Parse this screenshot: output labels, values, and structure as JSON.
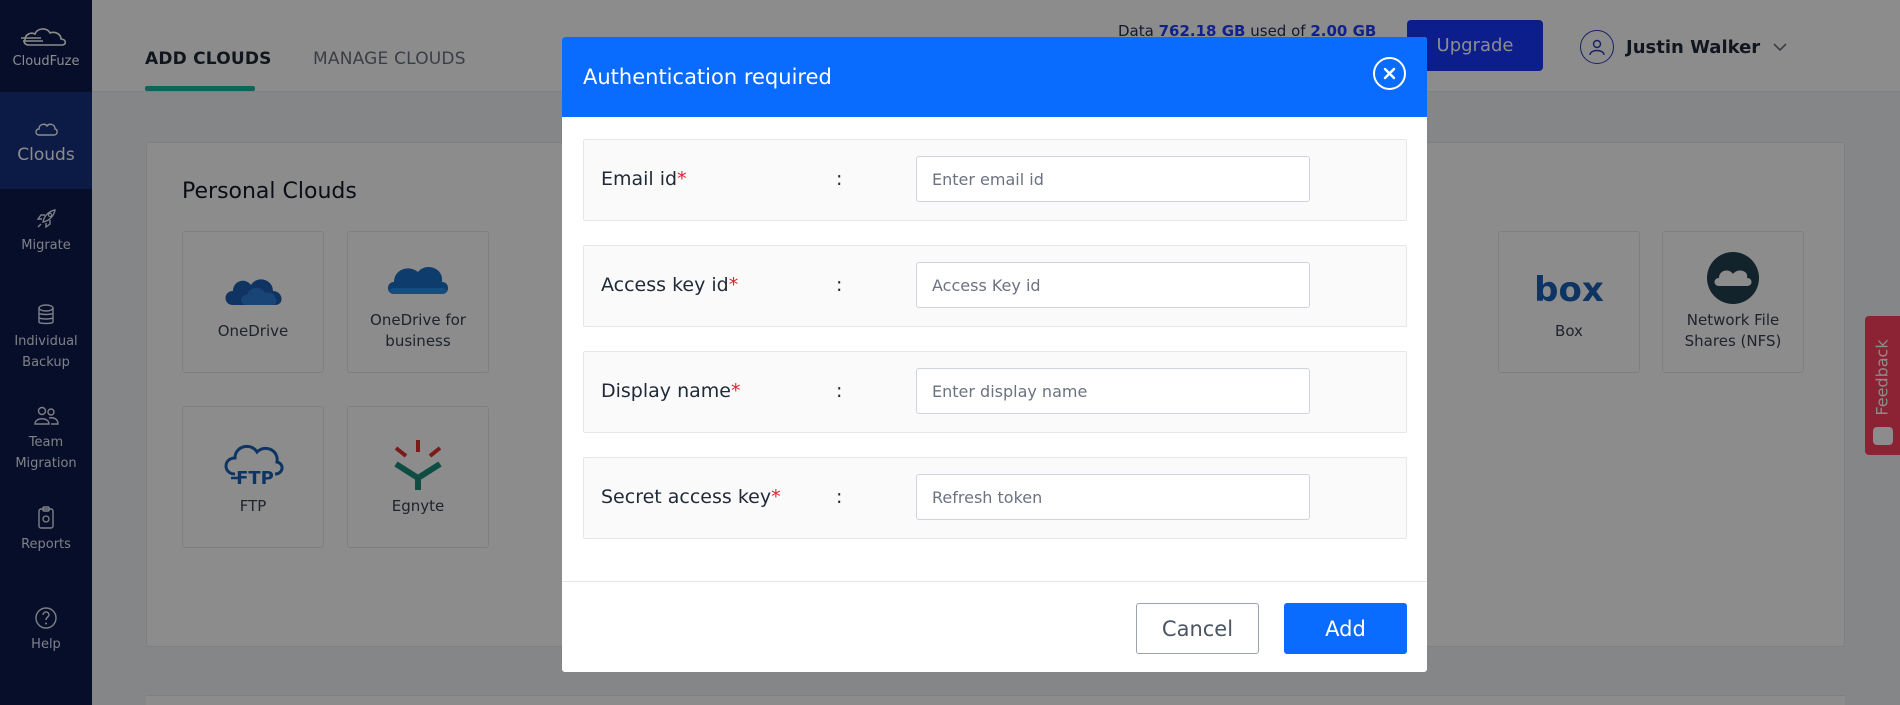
{
  "app": {
    "logo_text": "CloudFuze"
  },
  "sidebar": {
    "items": [
      {
        "label": "Clouds",
        "icon": "cloud-icon",
        "active": true
      },
      {
        "label": "Migrate",
        "icon": "rocket-icon"
      },
      {
        "label": "Individual Backup",
        "icon": "database-icon"
      },
      {
        "label": "Team Migration",
        "icon": "team-icon"
      },
      {
        "label": "Reports",
        "icon": "reports-icon"
      },
      {
        "label": "Help",
        "icon": "help-icon"
      }
    ]
  },
  "header": {
    "tabs": [
      {
        "label": "ADD CLOUDS",
        "active": true
      },
      {
        "label": "MANAGE CLOUDS",
        "active": false
      }
    ],
    "usage_prefix": "Data",
    "usage_used": "762.18 GB",
    "usage_middle": "used of",
    "usage_total": "2.00 GB",
    "upgrade_label": "Upgrade",
    "user_name": "Justin Walker"
  },
  "main": {
    "section_title": "Personal Clouds",
    "tiles": [
      {
        "label": "OneDrive",
        "icon": "onedrive-icon"
      },
      {
        "label": "OneDrive for business",
        "icon": "onedrive-business-icon"
      },
      {
        "label": "Box",
        "icon": "box-icon"
      },
      {
        "label": "Network File Shares (NFS)",
        "icon": "nfs-icon"
      },
      {
        "label": "FTP",
        "icon": "ftp-icon"
      },
      {
        "label": "Egnyte",
        "icon": "egnyte-icon"
      }
    ]
  },
  "feedback": {
    "label": "Feedback"
  },
  "modal": {
    "title": "Authentication required",
    "fields": [
      {
        "label": "Email id",
        "required": "*",
        "separator": ":",
        "placeholder": "Enter email id",
        "value": ""
      },
      {
        "label": "Access key id",
        "required": "*",
        "separator": ":",
        "placeholder": "Access Key id",
        "value": ""
      },
      {
        "label": "Display name",
        "required": "*",
        "separator": ":",
        "placeholder": "Enter display name",
        "value": ""
      },
      {
        "label": "Secret access key",
        "required": "*",
        "separator": ":",
        "placeholder": "Refresh token",
        "value": ""
      }
    ],
    "cancel_label": "Cancel",
    "add_label": "Add"
  },
  "colors": {
    "sidebar_bg": "#0b1a4b",
    "accent_blue": "#0a6cff",
    "upgrade_blue": "#1537ff",
    "tab_underline": "#1bb6a2",
    "required_red": "#e11d2e",
    "feedback_red": "#ff4060"
  }
}
